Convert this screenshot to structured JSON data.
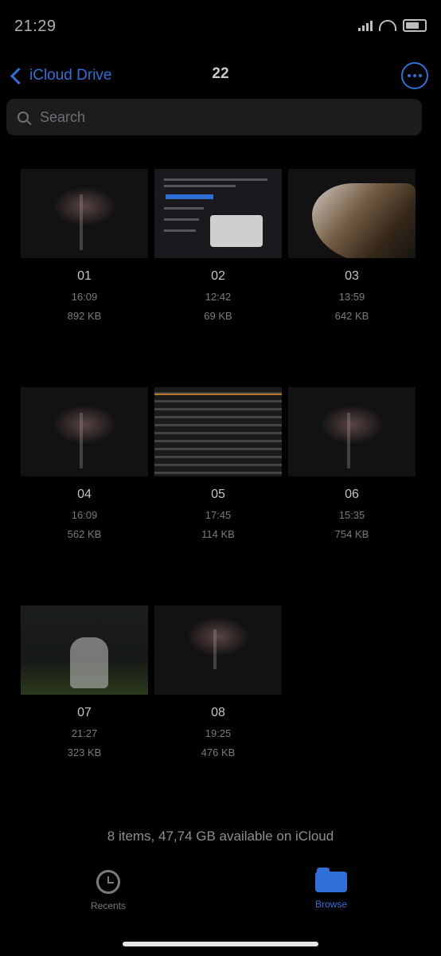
{
  "status_bar": {
    "time": "21:29"
  },
  "nav": {
    "back_label": "iCloud Drive",
    "title": "22"
  },
  "search": {
    "placeholder": "Search"
  },
  "files": [
    {
      "name": "01",
      "time": "16:09",
      "size": "892 KB"
    },
    {
      "name": "02",
      "time": "12:42",
      "size": "69 KB"
    },
    {
      "name": "03",
      "time": "13:59",
      "size": "642 KB"
    },
    {
      "name": "04",
      "time": "16:09",
      "size": "562 KB"
    },
    {
      "name": "05",
      "time": "17:45",
      "size": "114 KB"
    },
    {
      "name": "06",
      "time": "15:35",
      "size": "754 KB"
    },
    {
      "name": "07",
      "time": "21:27",
      "size": "323 KB"
    },
    {
      "name": "08",
      "time": "19:25",
      "size": "476 KB"
    }
  ],
  "footer": {
    "summary": "8 items, 47,74 GB available on iCloud"
  },
  "tabs": {
    "recents": "Recents",
    "browse": "Browse"
  },
  "colors": {
    "accent": "#2f6fd6",
    "background": "#000000"
  }
}
